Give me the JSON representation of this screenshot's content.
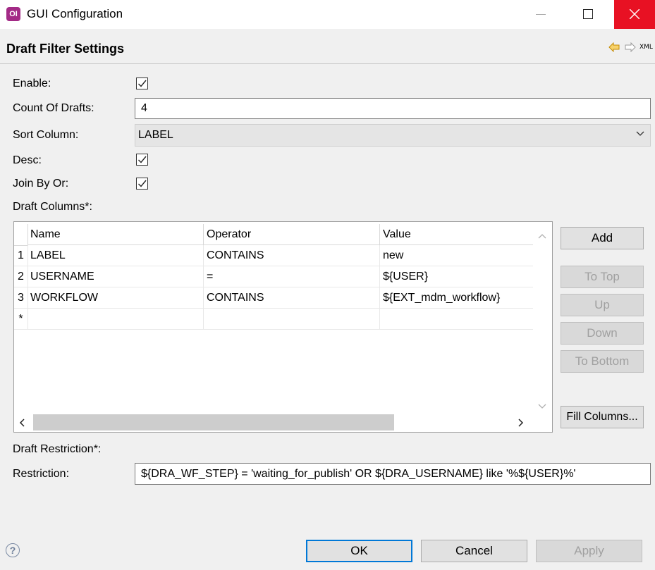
{
  "window": {
    "title": "GUI Configuration",
    "logo_text": "OI"
  },
  "header": {
    "title": "Draft Filter Settings",
    "xml_label": "XML"
  },
  "form": {
    "enable_label": "Enable:",
    "enable_checked": true,
    "count_label": "Count Of Drafts:",
    "count_value": "4",
    "sort_label": "Sort Column:",
    "sort_value": "LABEL",
    "desc_label": "Desc:",
    "desc_checked": true,
    "joinbyor_label": "Join By Or:",
    "joinbyor_checked": true,
    "draft_columns_label": "Draft Columns*:",
    "draft_restriction_label": "Draft Restriction*:",
    "restriction_label": "Restriction:",
    "restriction_value": "${DRA_WF_STEP} = 'waiting_for_publish' OR ${DRA_USERNAME} like '%${USER}%'"
  },
  "table": {
    "columns": [
      "Name",
      "Operator",
      "Value"
    ],
    "rows": [
      {
        "num": "1",
        "name": "LABEL",
        "operator": "CONTAINS",
        "value": "new"
      },
      {
        "num": "2",
        "name": "USERNAME",
        "operator": "=",
        "value": "${USER}"
      },
      {
        "num": "3",
        "name": "WORKFLOW",
        "operator": "CONTAINS",
        "value": "${EXT_mdm_workflow}"
      }
    ],
    "new_row_marker": "*"
  },
  "side_buttons": {
    "add": "Add",
    "to_top": "To Top",
    "up": "Up",
    "down": "Down",
    "to_bottom": "To Bottom",
    "fill_columns": "Fill Columns..."
  },
  "footer": {
    "help": "?",
    "ok": "OK",
    "cancel": "Cancel",
    "apply": "Apply"
  },
  "colors": {
    "close_button": "#e81123",
    "logo": "#a32a86",
    "ok_border": "#0078d7",
    "nav_back_arrow": "#e0a800"
  }
}
